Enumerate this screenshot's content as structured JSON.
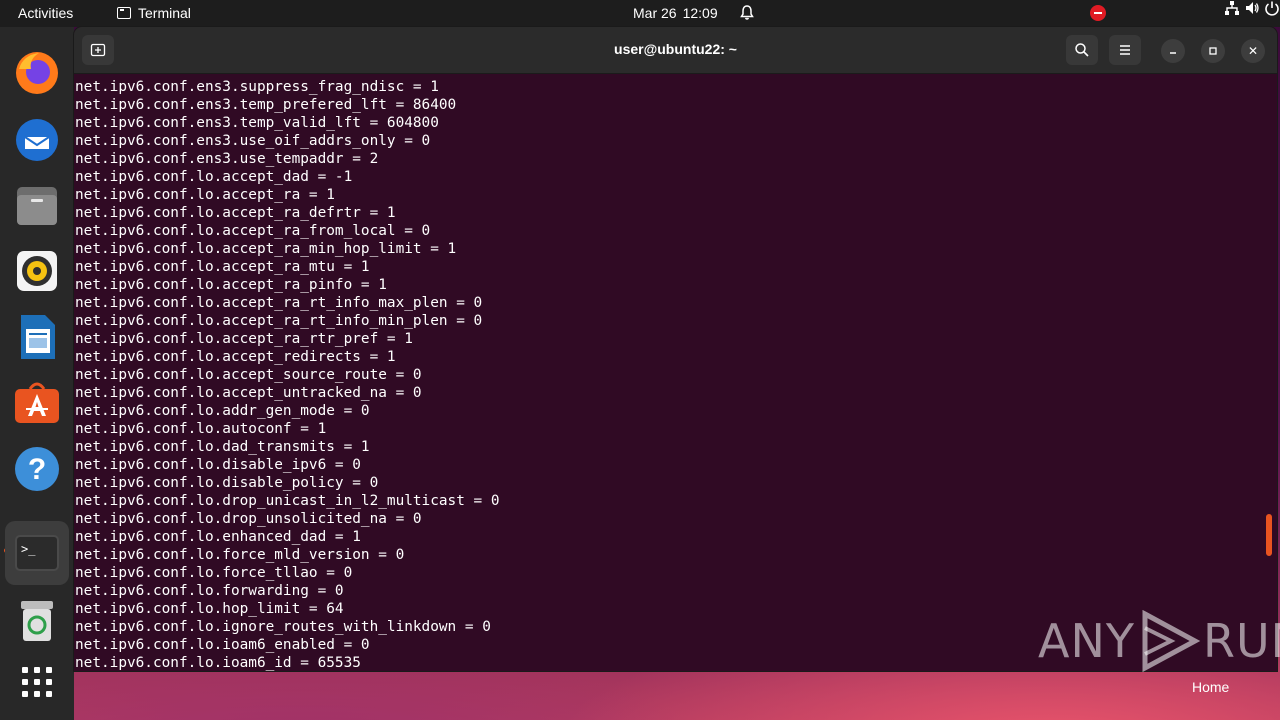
{
  "topbar": {
    "activities": "Activities",
    "app_name": "Terminal",
    "date": "Mar 26",
    "time": "12:09"
  },
  "dock": {
    "items": [
      {
        "name": "Firefox",
        "icon": "firefox-icon"
      },
      {
        "name": "Thunderbird",
        "icon": "thunderbird-icon"
      },
      {
        "name": "Files",
        "icon": "files-icon"
      },
      {
        "name": "Rhythmbox",
        "icon": "rhythmbox-icon"
      },
      {
        "name": "LibreOffice Writer",
        "icon": "writer-icon"
      },
      {
        "name": "Ubuntu Software",
        "icon": "software-icon"
      },
      {
        "name": "Help",
        "icon": "help-icon"
      },
      {
        "name": "Terminal",
        "icon": "terminal-icon",
        "active": true
      },
      {
        "name": "Trash",
        "icon": "trash-icon"
      },
      {
        "name": "Show Applications",
        "icon": "app-grid-icon"
      }
    ]
  },
  "window": {
    "title": "user@ubuntu22: ~",
    "close_glyph": "✕"
  },
  "terminal": {
    "lines": [
      "net.ipv6.conf.ens3.suppress_frag_ndisc = 1",
      "net.ipv6.conf.ens3.temp_prefered_lft = 86400",
      "net.ipv6.conf.ens3.temp_valid_lft = 604800",
      "net.ipv6.conf.ens3.use_oif_addrs_only = 0",
      "net.ipv6.conf.ens3.use_tempaddr = 2",
      "net.ipv6.conf.lo.accept_dad = -1",
      "net.ipv6.conf.lo.accept_ra = 1",
      "net.ipv6.conf.lo.accept_ra_defrtr = 1",
      "net.ipv6.conf.lo.accept_ra_from_local = 0",
      "net.ipv6.conf.lo.accept_ra_min_hop_limit = 1",
      "net.ipv6.conf.lo.accept_ra_mtu = 1",
      "net.ipv6.conf.lo.accept_ra_pinfo = 1",
      "net.ipv6.conf.lo.accept_ra_rt_info_max_plen = 0",
      "net.ipv6.conf.lo.accept_ra_rt_info_min_plen = 0",
      "net.ipv6.conf.lo.accept_ra_rtr_pref = 1",
      "net.ipv6.conf.lo.accept_redirects = 1",
      "net.ipv6.conf.lo.accept_source_route = 0",
      "net.ipv6.conf.lo.accept_untracked_na = 0",
      "net.ipv6.conf.lo.addr_gen_mode = 0",
      "net.ipv6.conf.lo.autoconf = 1",
      "net.ipv6.conf.lo.dad_transmits = 1",
      "net.ipv6.conf.lo.disable_ipv6 = 0",
      "net.ipv6.conf.lo.disable_policy = 0",
      "net.ipv6.conf.lo.drop_unicast_in_l2_multicast = 0",
      "net.ipv6.conf.lo.drop_unsolicited_na = 0",
      "net.ipv6.conf.lo.enhanced_dad = 1",
      "net.ipv6.conf.lo.force_mld_version = 0",
      "net.ipv6.conf.lo.force_tllao = 0",
      "net.ipv6.conf.lo.forwarding = 0",
      "net.ipv6.conf.lo.hop_limit = 64",
      "net.ipv6.conf.lo.ignore_routes_with_linkdown = 0",
      "net.ipv6.conf.lo.ioam6_enabled = 0",
      "net.ipv6.conf.lo.ioam6_id = 65535"
    ]
  },
  "watermark": {
    "left": "ANY",
    "right": "RUN"
  },
  "desktop": {
    "home_label": "Home"
  },
  "colors": {
    "terminal_bg": "#300a24",
    "accent": "#e95420",
    "topbar_bg": "#1d1d1d",
    "dock_bg": "#282828"
  }
}
